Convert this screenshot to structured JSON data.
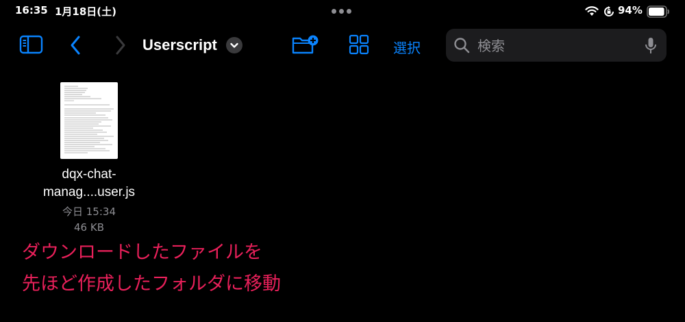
{
  "status_bar": {
    "time": "16:35",
    "date": "1月18日(土)",
    "battery_percent": "94%",
    "battery_level": 0.94
  },
  "toolbar": {
    "title": "Userscript",
    "select_label": "選択"
  },
  "search": {
    "placeholder": "検索"
  },
  "file": {
    "name_line1": "dqx-chat-",
    "name_line2": "manag....user.js",
    "date": "今日 15:34",
    "size": "46 KB"
  },
  "annotation": {
    "line1": "ダウンロードしたファイルを",
    "line2": "先ほど作成したフォルダに移動"
  },
  "colors": {
    "accent": "#0a84ff",
    "annotation": "#e8205a",
    "secondary_text": "#8e8e93",
    "background": "#000000"
  },
  "icons": [
    "sidebar-toggle-icon",
    "chevron-left-icon",
    "chevron-right-icon",
    "chevron-down-icon",
    "folder-plus-icon",
    "grid-view-icon",
    "search-icon",
    "microphone-icon",
    "wifi-icon",
    "orientation-lock-icon",
    "battery-icon"
  ]
}
